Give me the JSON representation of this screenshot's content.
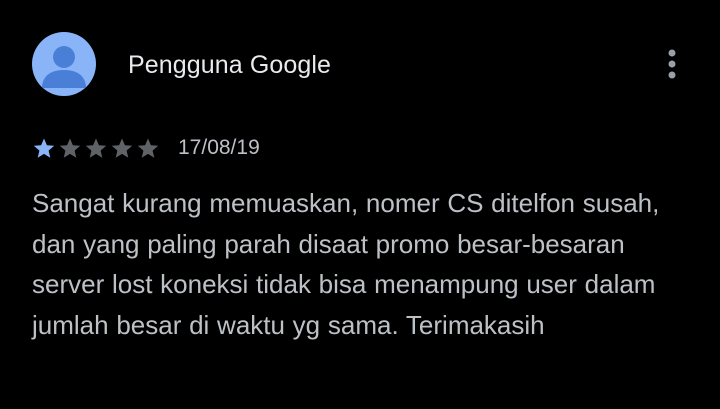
{
  "review": {
    "author": "Pengguna Google",
    "avatar_icon": "default-user-avatar-icon",
    "more_icon": "more-vertical-icon",
    "rating": 1,
    "max_rating": 5,
    "date": "17/08/19",
    "text": "Sangat kurang memuaskan, nomer CS ditelfon susah, dan yang paling parah disaat promo besar-besaran server lost koneksi tidak bisa menampung user dalam jumlah besar di waktu yg sama. Terimakasih"
  },
  "colors": {
    "background": "#000000",
    "star_filled": "#8ab4f8",
    "star_empty": "#5f6368",
    "avatar_bg": "#8ab4f8",
    "avatar_fg": "#4a7fd8"
  }
}
